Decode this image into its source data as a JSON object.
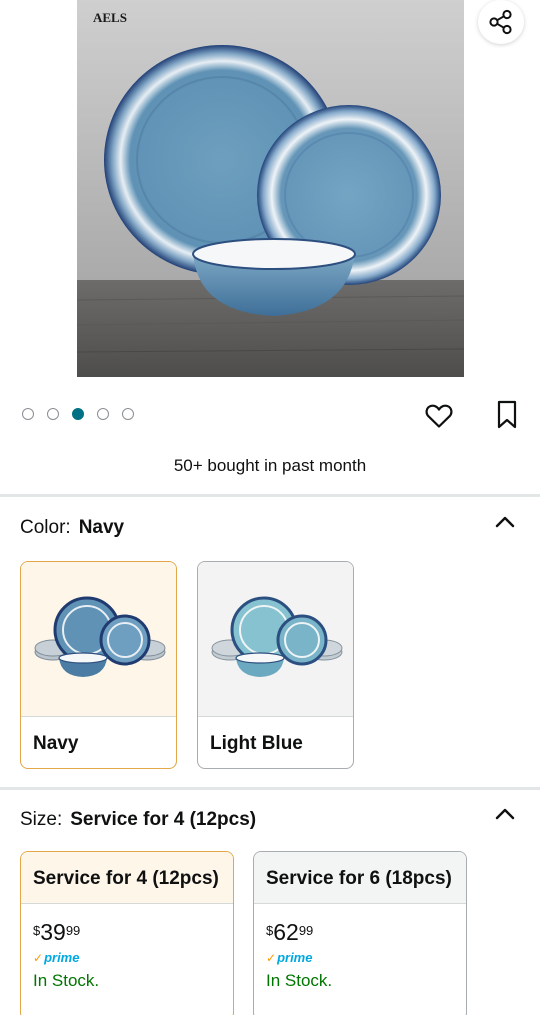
{
  "product_image": {
    "brand_mark": "AELS"
  },
  "image_carousel": {
    "total": 5,
    "active_index": 2
  },
  "bought_text": "50+ bought in past month",
  "color_section": {
    "label": "Color:",
    "selected": "Navy",
    "options": [
      {
        "label": "Navy",
        "selected": true
      },
      {
        "label": "Light Blue",
        "selected": false
      }
    ]
  },
  "size_section": {
    "label": "Size:",
    "selected": "Service for 4 (12pcs)",
    "options": [
      {
        "label": "Service for 4 (12pcs)",
        "currency": "$",
        "price_whole": "39",
        "price_fraction": "99",
        "prime": "prime",
        "stock": "In Stock.",
        "selected": true
      },
      {
        "label": "Service for 6 (18pcs)",
        "currency": "$",
        "price_whole": "62",
        "price_fraction": "99",
        "prime": "prime",
        "stock": "In Stock.",
        "selected": false
      }
    ]
  },
  "icons": {
    "share": "share-icon",
    "favorite": "heart-icon",
    "save": "bookmark-icon",
    "collapse": "chevron-up-icon"
  },
  "colors": {
    "accent_teal": "#007185",
    "selected_border": "#e3a74a",
    "prime_blue": "#00a8e1",
    "in_stock_green": "#007600"
  }
}
